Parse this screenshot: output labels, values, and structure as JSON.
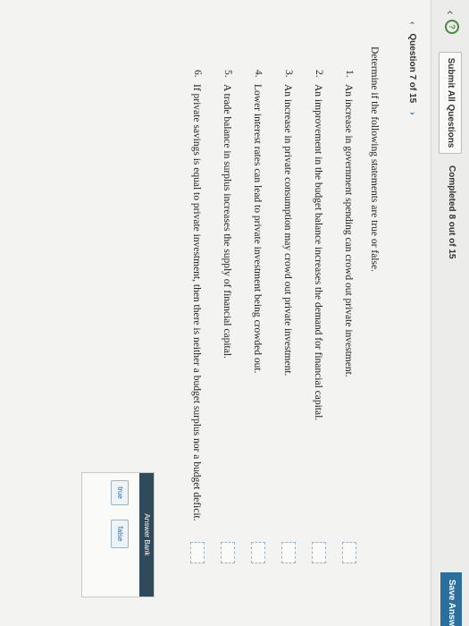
{
  "topbar": {
    "submit_label": "Submit All Questions",
    "completed_text": "Completed 8 out of 15",
    "save_label": "Save Answ"
  },
  "question_nav": {
    "label": "Question 7 of 15",
    "prev_icon": "chevron-left-icon",
    "next_icon": "chevron-right-icon"
  },
  "prompt": "Determine if the following statements are true or false.",
  "statements": [
    {
      "num": "1.",
      "text": "An increase in government spending can crowd out private investment."
    },
    {
      "num": "2.",
      "text": "An improvement in the budget balance increases the demand for financial capital."
    },
    {
      "num": "3.",
      "text": "An increase in private consumption may crowd out private investment."
    },
    {
      "num": "4.",
      "text": "Lower interest rates can lead to private investment being crowded out."
    },
    {
      "num": "5.",
      "text": "A trade balance in surplus increases the supply of financial capital."
    },
    {
      "num": "6.",
      "text": "If private savings is equal to private investment, then there is neither a budget surplus nor a budget deficit."
    }
  ],
  "answer_bank": {
    "title": "Answer Bank",
    "options": [
      "true",
      "false"
    ]
  },
  "colors": {
    "accent": "#2c6e9c",
    "bank_header": "#2f4a5a",
    "help_icon": "#4a8a3c"
  }
}
